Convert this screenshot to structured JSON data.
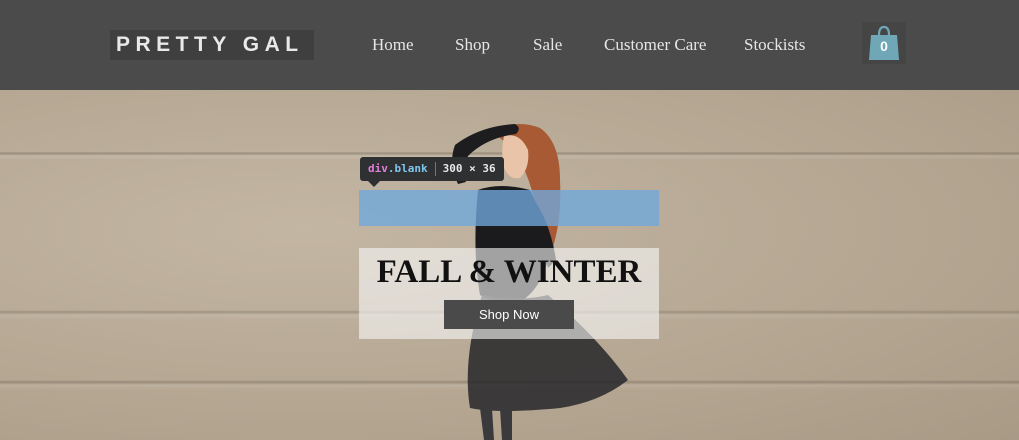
{
  "header": {
    "logo": "PRETTY GAL",
    "nav": [
      "Home",
      "Shop",
      "Sale",
      "Customer Care",
      "Stockists"
    ],
    "cart_count": "0",
    "cart_icon": "shopping-bag-icon"
  },
  "devtools": {
    "tag": "div",
    "class_name": ".blank",
    "size": "300 × 36",
    "highlight_color": "#6fa8dc"
  },
  "hero": {
    "title": "FALL & WINTER",
    "cta_label": "Shop Now"
  },
  "colors": {
    "header_bg": "#4b4b4b",
    "cart_accent": "#6fa7b6",
    "button_bg": "#4a4a4a"
  }
}
